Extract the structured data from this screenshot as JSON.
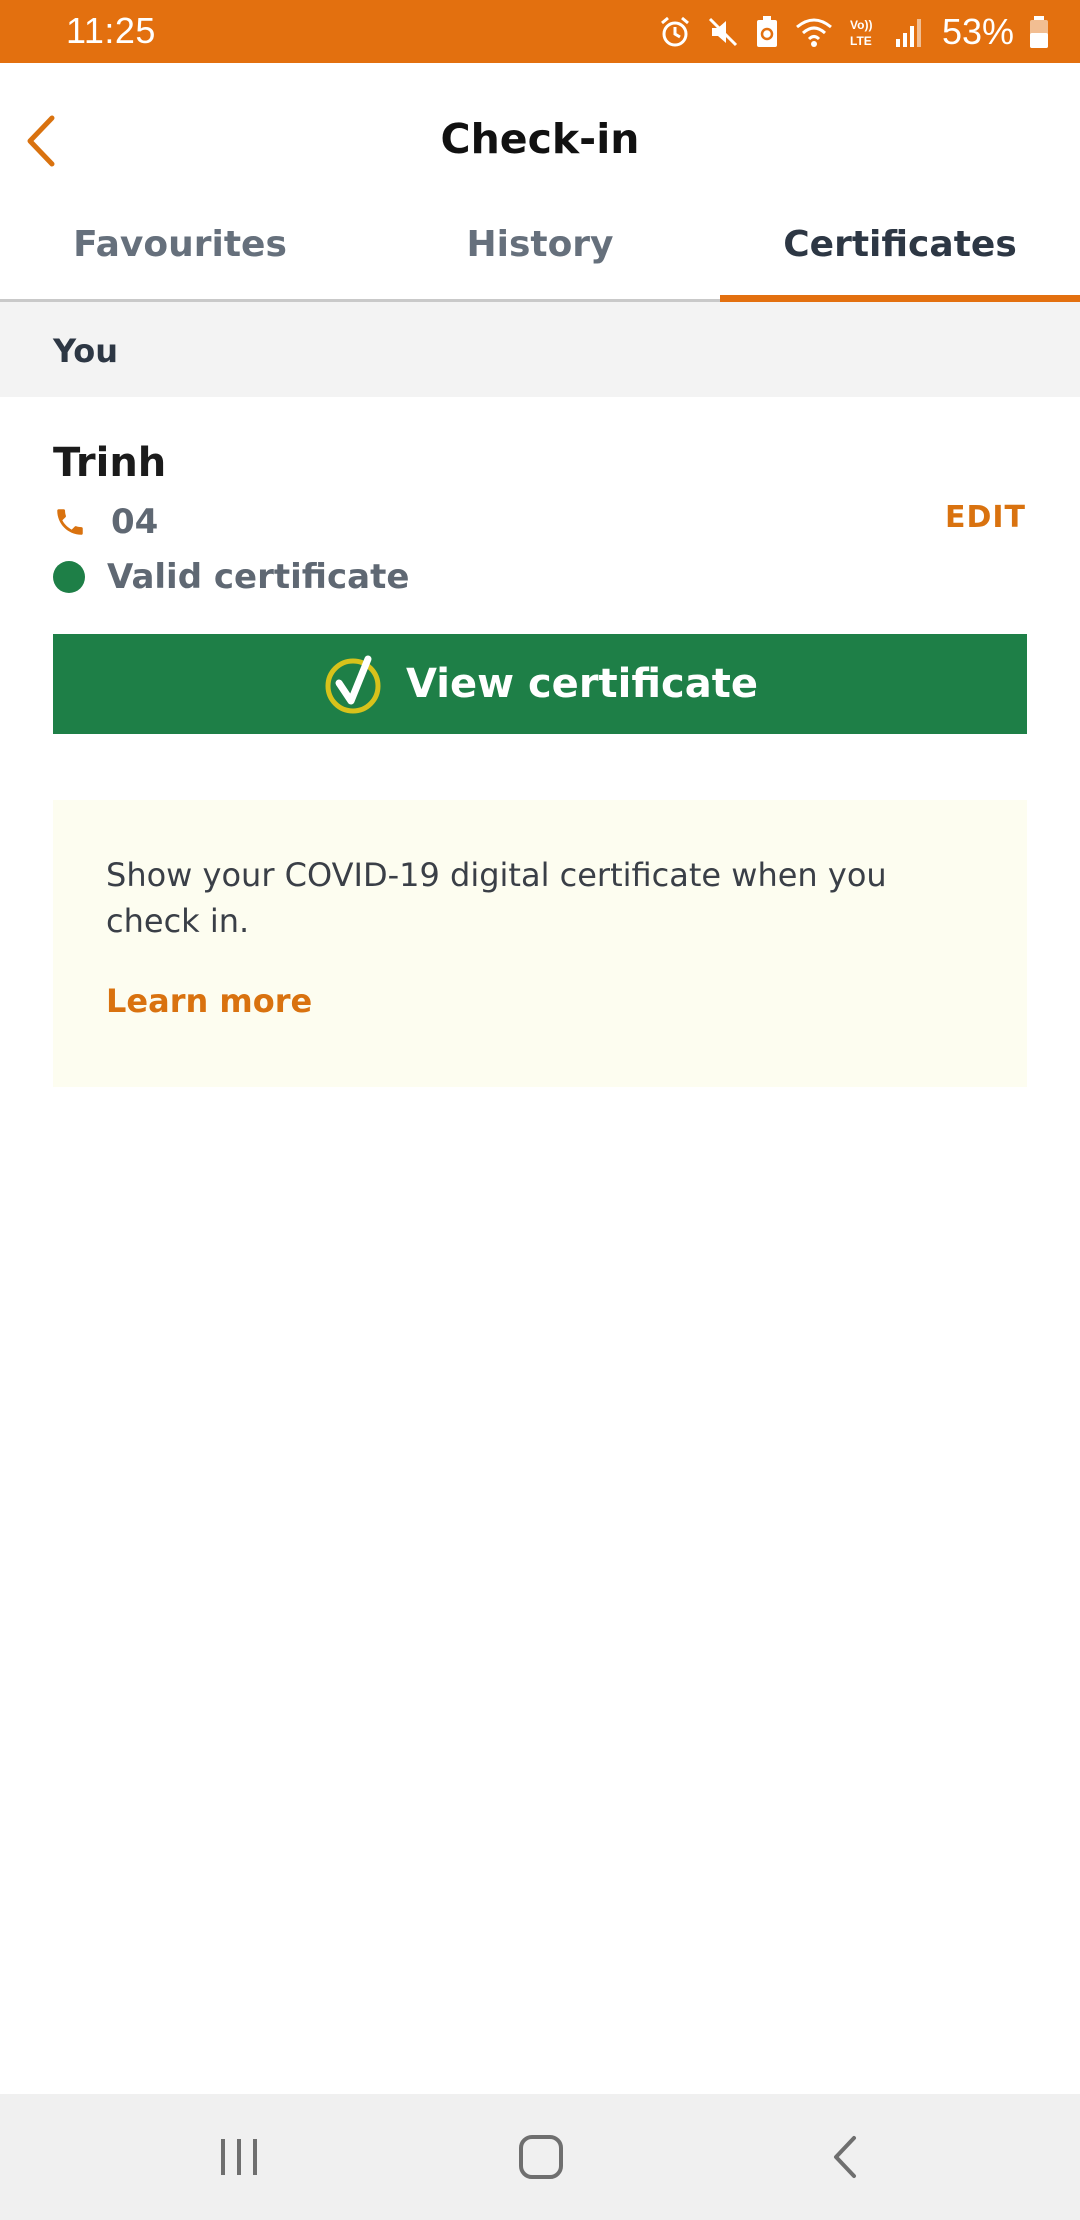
{
  "status_bar": {
    "time": "11:25",
    "battery": "53%",
    "icons": [
      "alarm-icon",
      "mute-icon",
      "battery-saver-icon",
      "wifi-icon",
      "volte-icon",
      "signal-icon",
      "battery-icon"
    ],
    "volte_label": "Vo)) LTE"
  },
  "header": {
    "title": "Check-in",
    "back_icon": "chevron-left-icon"
  },
  "tabs": [
    {
      "label": "Favourites",
      "active": false
    },
    {
      "label": "History",
      "active": false
    },
    {
      "label": "Certificates",
      "active": true
    }
  ],
  "section": {
    "title": "You"
  },
  "person": {
    "name": "Trinh",
    "phone": "04",
    "phone_icon": "phone-icon",
    "edit_label": "EDIT",
    "status": "Valid certificate",
    "status_color": "#1e7f47"
  },
  "view_button": {
    "label": "View certificate",
    "icon": "check-circle-icon"
  },
  "info": {
    "text": "Show your COVID-19 digital certificate when you check in.",
    "link": "Learn more"
  },
  "colors": {
    "accent": "#e3700f",
    "green": "#1e7f47"
  },
  "nav_bar": {
    "buttons": [
      "recents-icon",
      "home-icon",
      "back-icon"
    ]
  }
}
